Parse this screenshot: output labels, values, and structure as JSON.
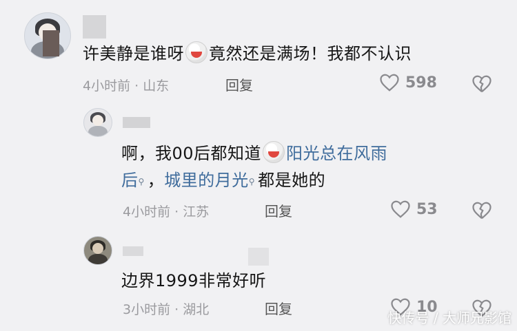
{
  "comments": [
    {
      "text": "许美静是谁呀",
      "text_after_emoji": "竟然还是满场！我都不认识",
      "time": "4小时前",
      "location": "山东",
      "reply_label": "回复",
      "likes": "598"
    },
    {
      "text": "啊，我00后都知道",
      "link1": "阳光总在风雨",
      "link1_cont": "后",
      "sep": "，",
      "link2": "城里的月光",
      "text_tail": "都是她的",
      "time": "4小时前",
      "location": "江苏",
      "reply_label": "回复",
      "likes": "53"
    },
    {
      "text": "边界1999非常好听",
      "time": "3小时前",
      "location": "湖北",
      "reply_label": "回复",
      "likes": "10"
    }
  ],
  "meta_separator": " · ",
  "watermark": "快传号 / 大师兄影馆"
}
